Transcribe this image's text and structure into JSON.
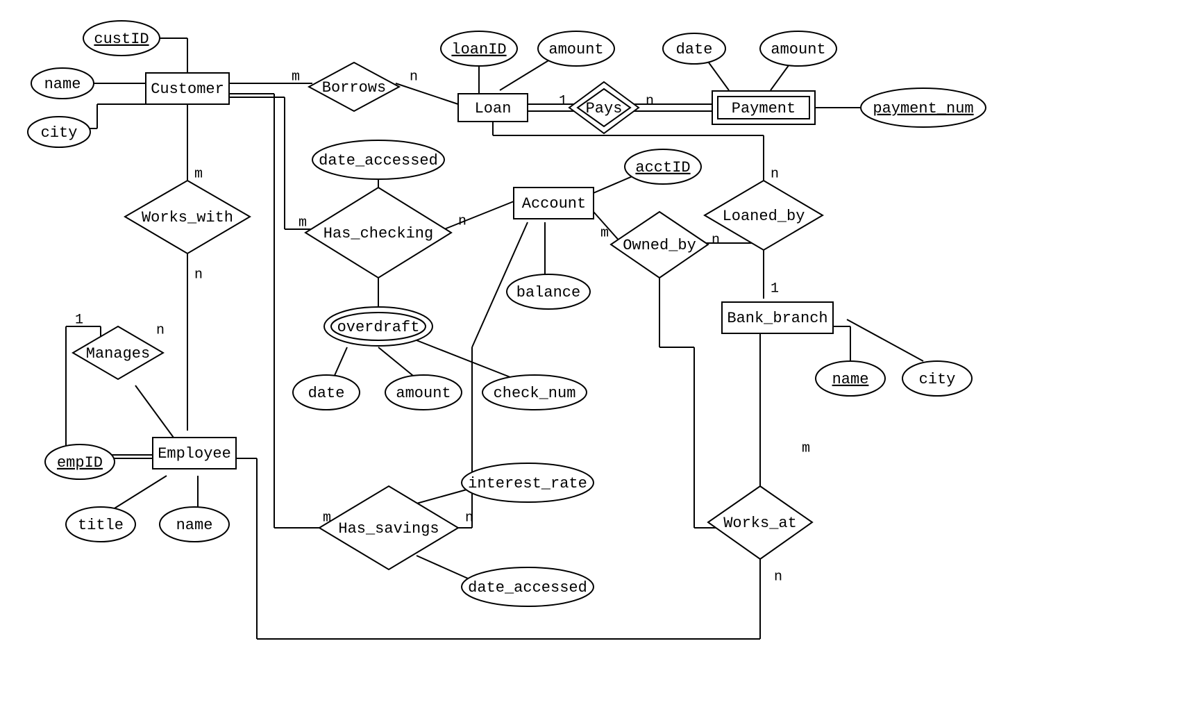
{
  "entities": {
    "customer": "Customer",
    "loan": "Loan",
    "payment": "Payment",
    "account": "Account",
    "bank_branch": "Bank_branch",
    "employee": "Employee"
  },
  "relationships": {
    "borrows": "Borrows",
    "pays": "Pays",
    "works_with": "Works_with",
    "has_checking": "Has_checking",
    "owned_by": "Owned_by",
    "loaned_by": "Loaned_by",
    "manages": "Manages",
    "has_savings": "Has_savings",
    "works_at": "Works_at"
  },
  "attributes": {
    "custID": "custID",
    "cust_name": "name",
    "cust_city": "city",
    "loanID": "loanID",
    "loan_amount": "amount",
    "pay_date": "date",
    "pay_amount": "amount",
    "payment_num": "payment_num",
    "date_accessed": "date_accessed",
    "overdraft": "overdraft",
    "od_date": "date",
    "od_amount": "amount",
    "od_check_num": "check_num",
    "acctID": "acctID",
    "balance": "balance",
    "branch_name": "name",
    "branch_city": "city",
    "empID": "empID",
    "emp_title": "title",
    "emp_name": "name",
    "interest_rate": "interest_rate",
    "sav_date_accessed": "date_accessed"
  },
  "cardinalities": {
    "m": "m",
    "n": "n",
    "one": "1"
  }
}
